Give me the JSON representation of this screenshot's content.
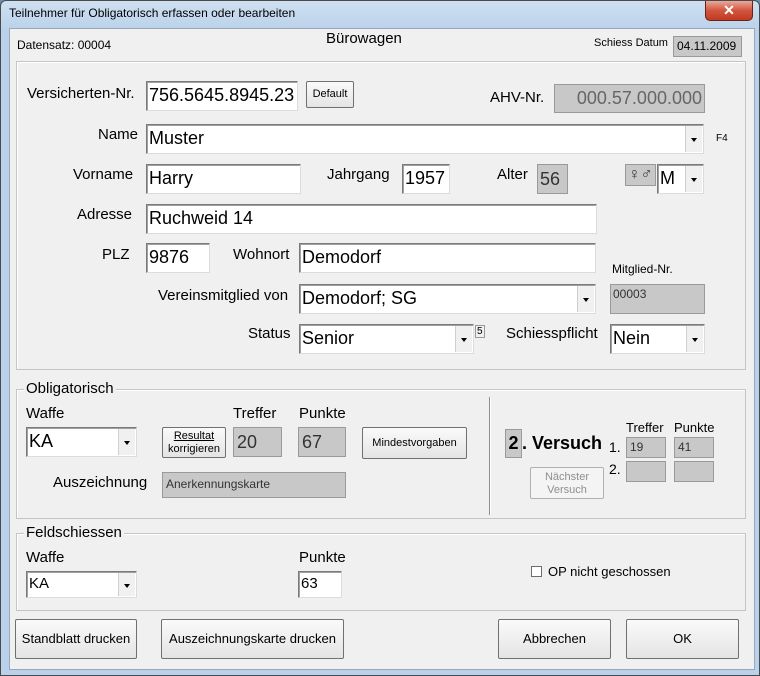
{
  "window": {
    "title": "Teilnehmer für Obligatorisch erfassen oder bearbeiten",
    "close_glyph": "✕"
  },
  "header": {
    "datensatz": "Datensatz: 00004",
    "group_name": "Bürowagen",
    "schiess_datum_label": "Schiess Datum",
    "schiess_datum": "04.11.2009"
  },
  "person": {
    "versicherten_label": "Versicherten-Nr.",
    "versicherten_value": "756.5645.8945.23",
    "default_button": "Default",
    "ahv_label": "AHV-Nr.",
    "ahv_value": "000.57.000.000",
    "name_label": "Name",
    "name_value": "Muster",
    "name_hotkey": "F4",
    "vorname_label": "Vorname",
    "vorname_value": "Harry",
    "jahrgang_label": "Jahrgang",
    "jahrgang_value": "1957",
    "alter_label": "Alter",
    "alter_value": "56",
    "gender_icon": "♀♂",
    "gender_value": "M",
    "adresse_label": "Adresse",
    "adresse_value": "Ruchweid 14",
    "plz_label": "PLZ",
    "plz_value": "9876",
    "wohnort_label": "Wohnort",
    "wohnort_value": "Demodorf",
    "mitglied_nr_label": "Mitglied-Nr.",
    "mitglied_nr_value": "00003",
    "verein_label": "Vereinsmitglied von",
    "verein_value": "Demodorf;  SG",
    "status_label": "Status",
    "status_value": "Senior",
    "status_sup": "5",
    "schiesspflicht_label": "Schiesspflicht",
    "schiesspflicht_value": "Nein"
  },
  "obligatorisch": {
    "group_title": "Obligatorisch",
    "waffe_label": "Waffe",
    "waffe_value": "KA",
    "resultat_button_line1": "Resultat",
    "resultat_button_line2": "korrigieren",
    "treffer_label": "Treffer",
    "treffer_value": "20",
    "punkte_label": "Punkte",
    "punkte_value": "67",
    "mindest_button": "Mindestvorgaben",
    "auszeichnung_label": "Auszeichnung",
    "auszeichnung_value": "Anerkennungskarte",
    "versuch_number": "2",
    "versuch_label": ". Versuch",
    "naechster_button_line1": "Nächster",
    "naechster_button_line2": "Versuch",
    "v_treffer_label": "Treffer",
    "v_punkte_label": "Punkte",
    "row1_label": "1.",
    "row1_treffer": "19",
    "row1_punkte": "41",
    "row2_label": "2.",
    "row2_treffer": "",
    "row2_punkte": ""
  },
  "feldschiessen": {
    "group_title": "Feldschiessen",
    "waffe_label": "Waffe",
    "waffe_value": "KA",
    "punkte_label": "Punkte",
    "punkte_value": "63",
    "op_label": "OP nicht geschossen",
    "op_checked": false
  },
  "footer": {
    "standblatt_button": "Standblatt drucken",
    "auszeichnungskarte_button": "Auszeichnungskarte drucken",
    "abbrechen_button": "Abbrechen",
    "ok_button": "OK"
  }
}
